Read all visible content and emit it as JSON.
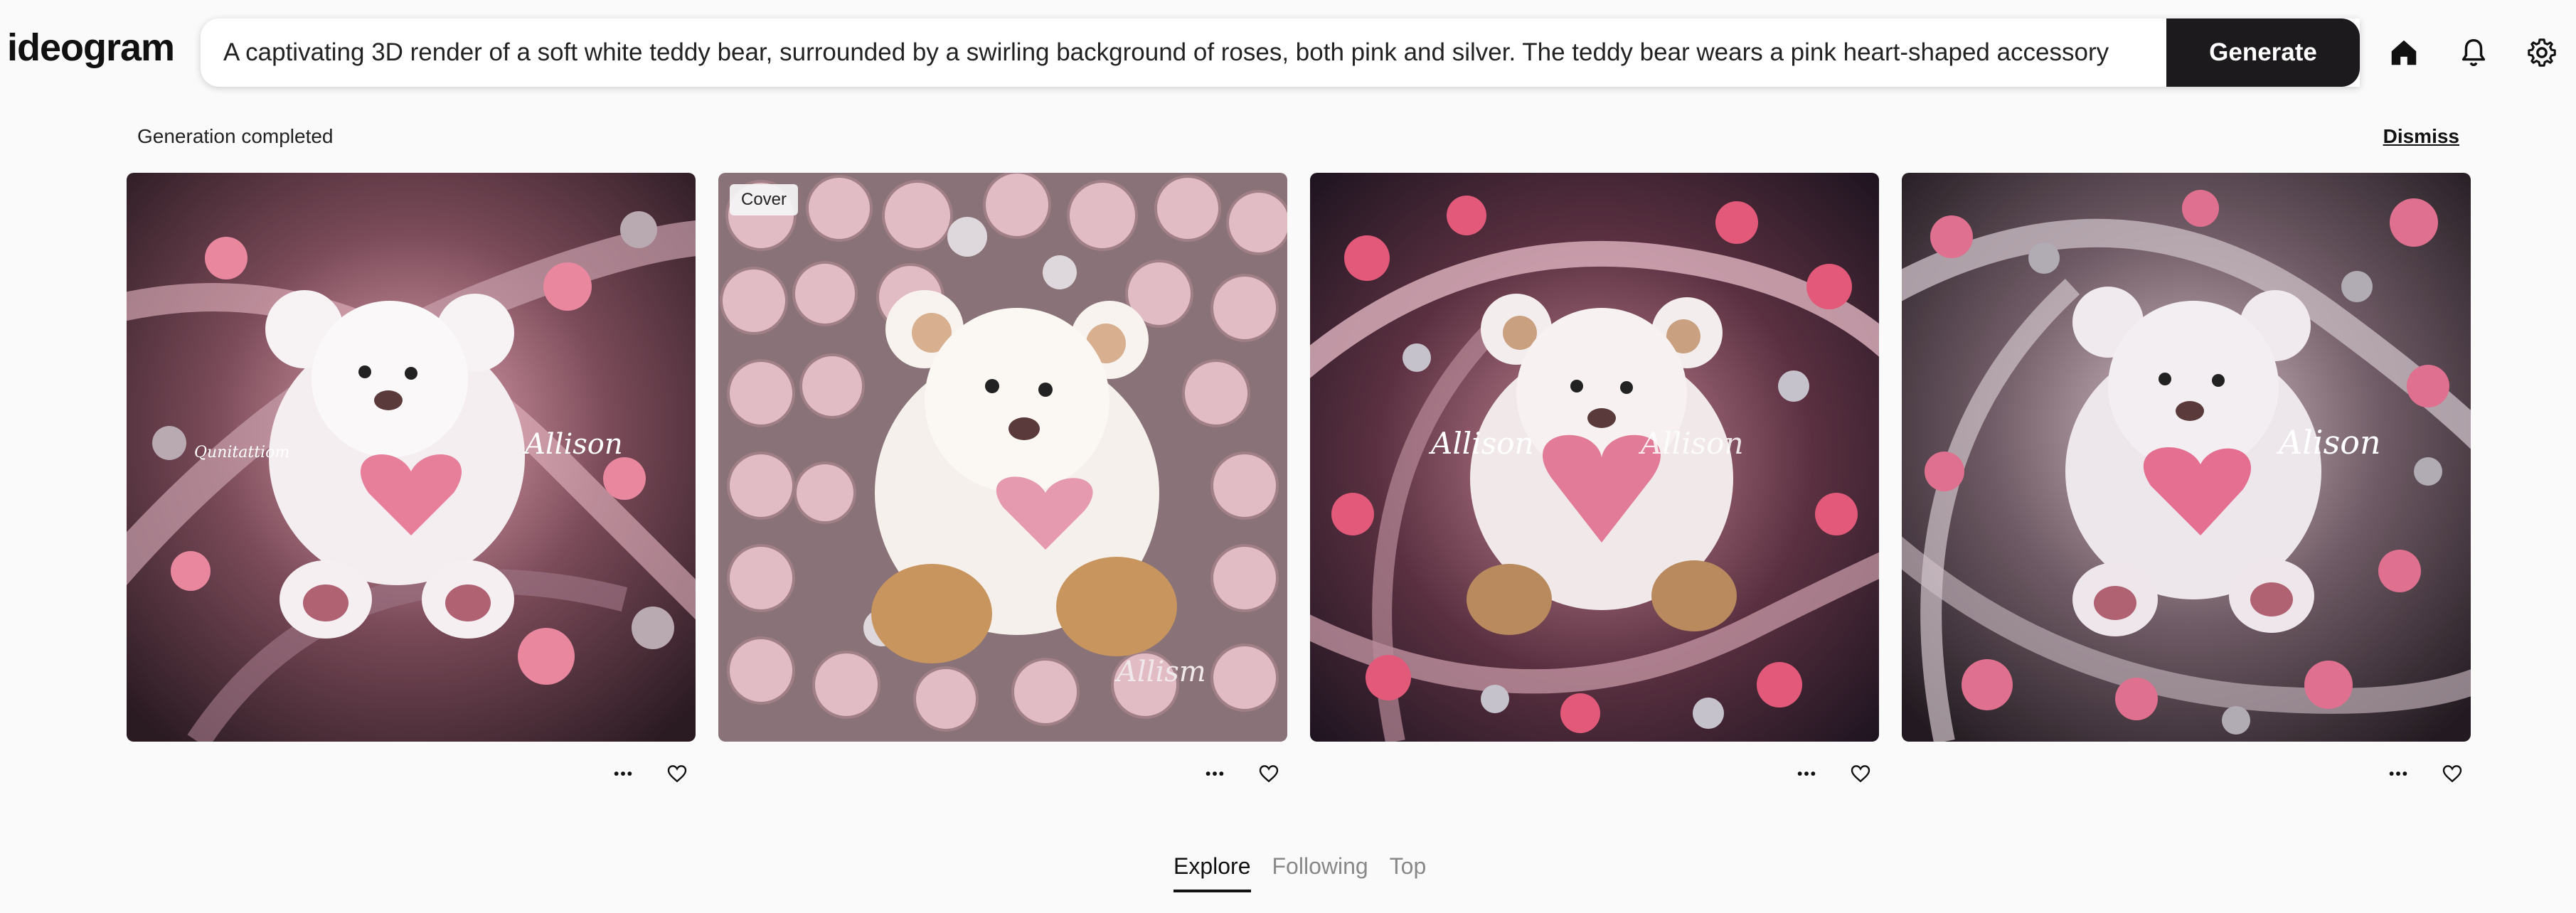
{
  "header": {
    "logo": "ideogram",
    "prompt_value": "A captivating 3D render of a soft white teddy bear, surrounded by a swirling background of roses, both pink and silver. The teddy bear wears a pink heart-shaped accessory",
    "generate_label": "Generate",
    "icons": [
      "home-icon",
      "bell-icon",
      "gear-icon"
    ]
  },
  "status": {
    "text": "Generation completed",
    "dismiss_label": "Dismiss"
  },
  "results": [
    {
      "name_text": "Allison",
      "extra_text": "Qunitattiom",
      "cover": false
    },
    {
      "name_text": "Allism",
      "cover": true,
      "cover_label": "Cover"
    },
    {
      "name_text": "Allison",
      "name_text_2": "Allison",
      "cover": false
    },
    {
      "name_text": "Alison",
      "cover": false
    }
  ],
  "tabs": [
    {
      "label": "Explore",
      "active": true
    },
    {
      "label": "Following",
      "active": false
    },
    {
      "label": "Top",
      "active": false
    }
  ],
  "colors": {
    "generate_bg": "#1c1a1c",
    "background": "#fafafa",
    "rose_pink": "#d9607f",
    "silver": "#b8b0b8"
  }
}
